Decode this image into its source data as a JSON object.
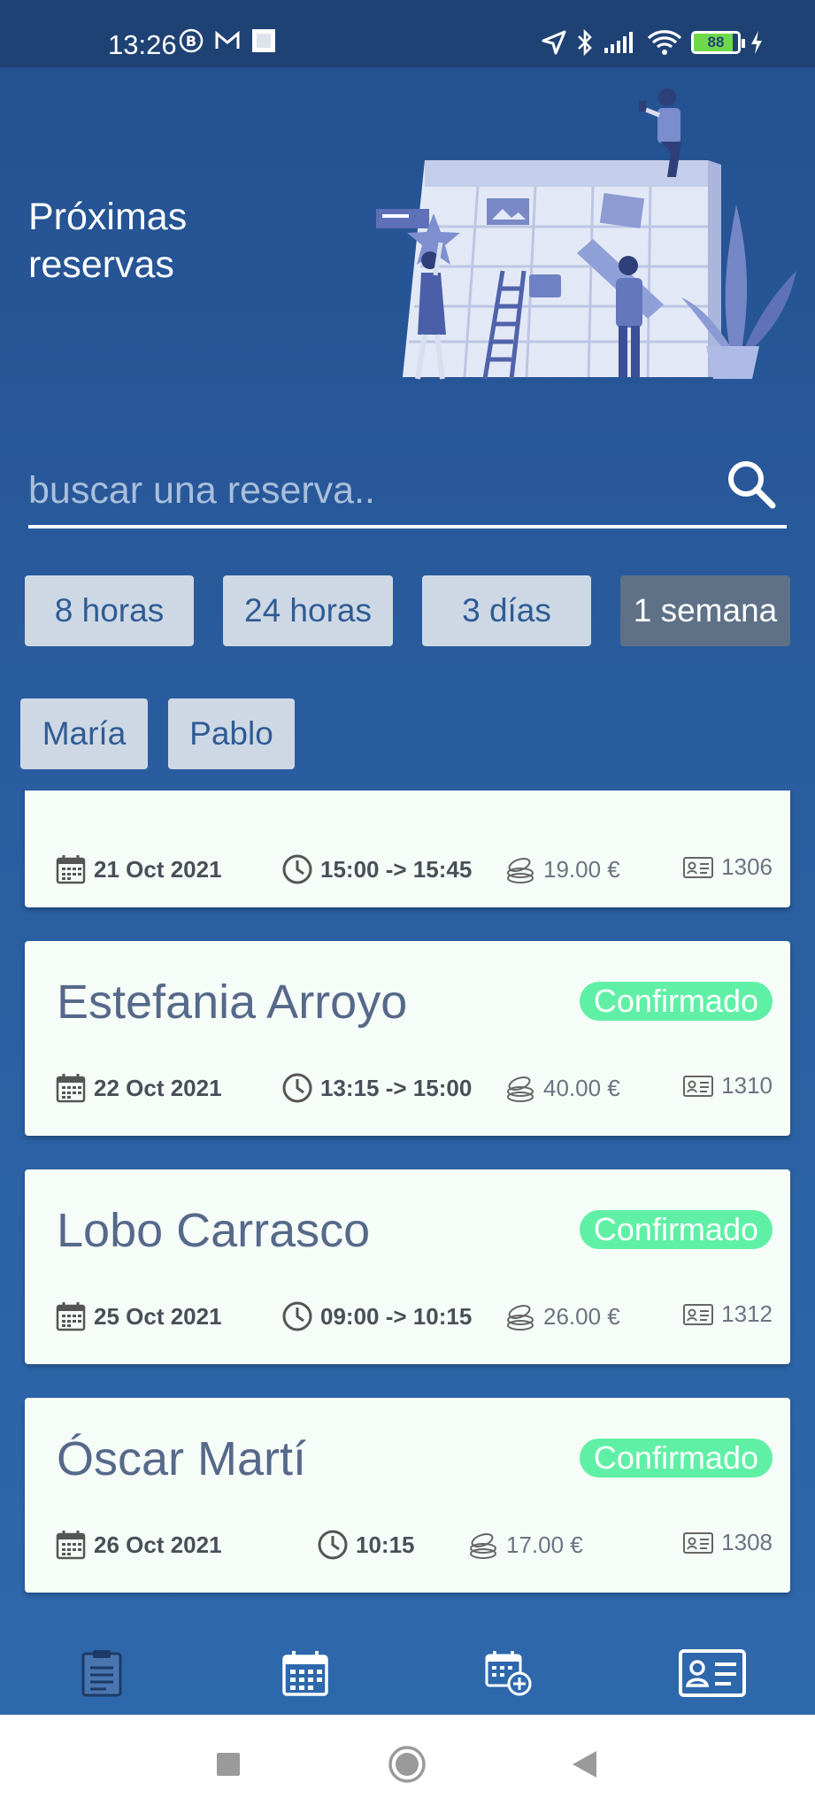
{
  "status_bar": {
    "time": "13:26",
    "battery": "88"
  },
  "header": {
    "title": "Próximas reservas"
  },
  "search": {
    "placeholder": "buscar una reserva.."
  },
  "time_filters": [
    {
      "label": "8 horas",
      "active": false
    },
    {
      "label": "24 horas",
      "active": false
    },
    {
      "label": "3 días",
      "active": false
    },
    {
      "label": "1 semana",
      "active": true
    }
  ],
  "staff_filters": [
    {
      "label": "María"
    },
    {
      "label": "Pablo"
    }
  ],
  "colors": {
    "accent_active": "#5e7187",
    "badge": "#5ff0a6",
    "card_bg": "#f6fdf8",
    "name_text": "#56698a"
  },
  "reservations": [
    {
      "name": "",
      "status": "",
      "date": "21 Oct 2021",
      "time": "15:00 -> 15:45",
      "price": "19.00 €",
      "id": "1306"
    },
    {
      "name": "Estefania Arroyo",
      "status": "Confirmado",
      "date": "22 Oct 2021",
      "time": "13:15 -> 15:00",
      "price": "40.00 €",
      "id": "1310"
    },
    {
      "name": "Lobo Carrasco",
      "status": "Confirmado",
      "date": "25 Oct 2021",
      "time": "09:00 -> 10:15",
      "price": "26.00 €",
      "id": "1312"
    },
    {
      "name": "Óscar Martí",
      "status": "Confirmado",
      "date": "26 Oct 2021",
      "time": "10:15",
      "price": "17.00 €",
      "id": "1308"
    }
  ],
  "bottom_nav": [
    {
      "icon": "clipboard-icon"
    },
    {
      "icon": "calendar-icon"
    },
    {
      "icon": "calendar-add-icon"
    },
    {
      "icon": "id-card-icon"
    }
  ]
}
